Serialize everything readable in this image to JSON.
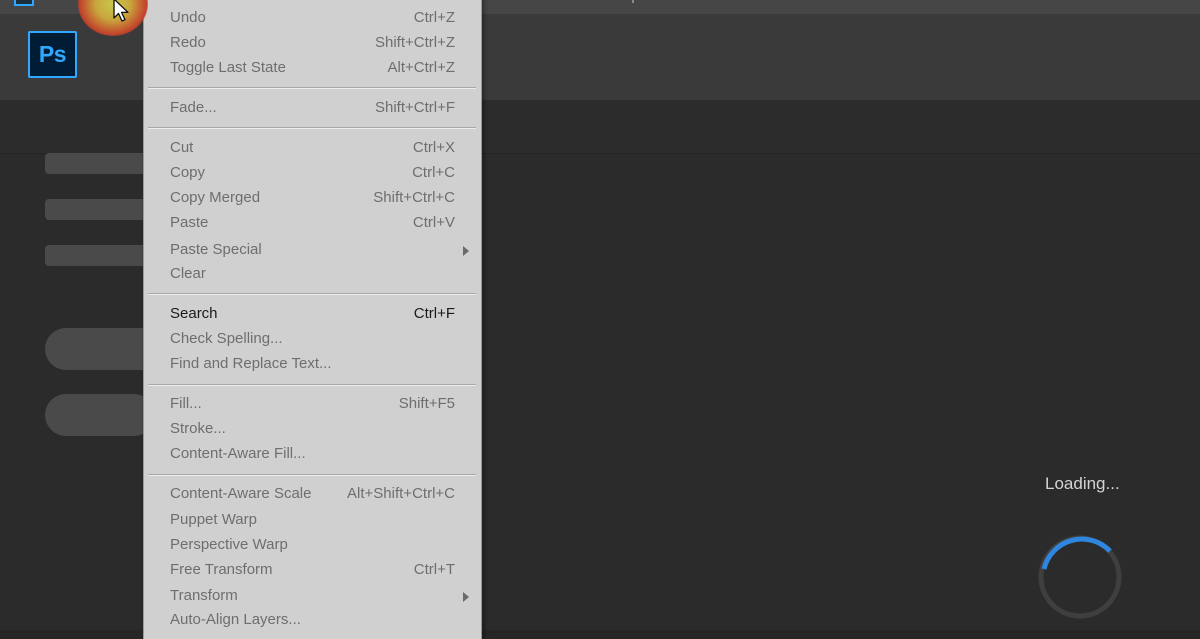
{
  "app": {
    "name": "Ps"
  },
  "status": {
    "loading_text": "Loading..."
  },
  "edit_menu": {
    "items": [
      {
        "label": "Undo",
        "shortcut": "Ctrl+Z",
        "enabled": false
      },
      {
        "label": "Redo",
        "shortcut": "Shift+Ctrl+Z",
        "enabled": false
      },
      {
        "label": "Toggle Last State",
        "shortcut": "Alt+Ctrl+Z",
        "enabled": false
      },
      {
        "label": "Fade...",
        "shortcut": "Shift+Ctrl+F",
        "enabled": false
      },
      {
        "label": "Cut",
        "shortcut": "Ctrl+X",
        "enabled": false
      },
      {
        "label": "Copy",
        "shortcut": "Ctrl+C",
        "enabled": false
      },
      {
        "label": "Copy Merged",
        "shortcut": "Shift+Ctrl+C",
        "enabled": false
      },
      {
        "label": "Paste",
        "shortcut": "Ctrl+V",
        "enabled": false
      },
      {
        "label": "Paste Special",
        "shortcut": "",
        "enabled": false,
        "submenu": true
      },
      {
        "label": "Clear",
        "shortcut": "",
        "enabled": false
      },
      {
        "label": "Search",
        "shortcut": "Ctrl+F",
        "enabled": true
      },
      {
        "label": "Check Spelling...",
        "shortcut": "",
        "enabled": false
      },
      {
        "label": "Find and Replace Text...",
        "shortcut": "",
        "enabled": false
      },
      {
        "label": "Fill...",
        "shortcut": "Shift+F5",
        "enabled": false
      },
      {
        "label": "Stroke...",
        "shortcut": "",
        "enabled": false
      },
      {
        "label": "Content-Aware Fill...",
        "shortcut": "",
        "enabled": false
      },
      {
        "label": "Content-Aware Scale",
        "shortcut": "Alt+Shift+Ctrl+C",
        "enabled": false
      },
      {
        "label": "Puppet Warp",
        "shortcut": "",
        "enabled": false
      },
      {
        "label": "Perspective Warp",
        "shortcut": "",
        "enabled": false
      },
      {
        "label": "Free Transform",
        "shortcut": "Ctrl+T",
        "enabled": false
      },
      {
        "label": "Transform",
        "shortcut": "",
        "enabled": false,
        "submenu": true
      },
      {
        "label": "Auto-Align Layers...",
        "shortcut": "",
        "enabled": false
      }
    ]
  },
  "colors": {
    "accent": "#31a8ff",
    "menu_bg": "#d0d0d0",
    "disabled_text": "#6e6e6e",
    "enabled_text": "#1b1b1b"
  }
}
